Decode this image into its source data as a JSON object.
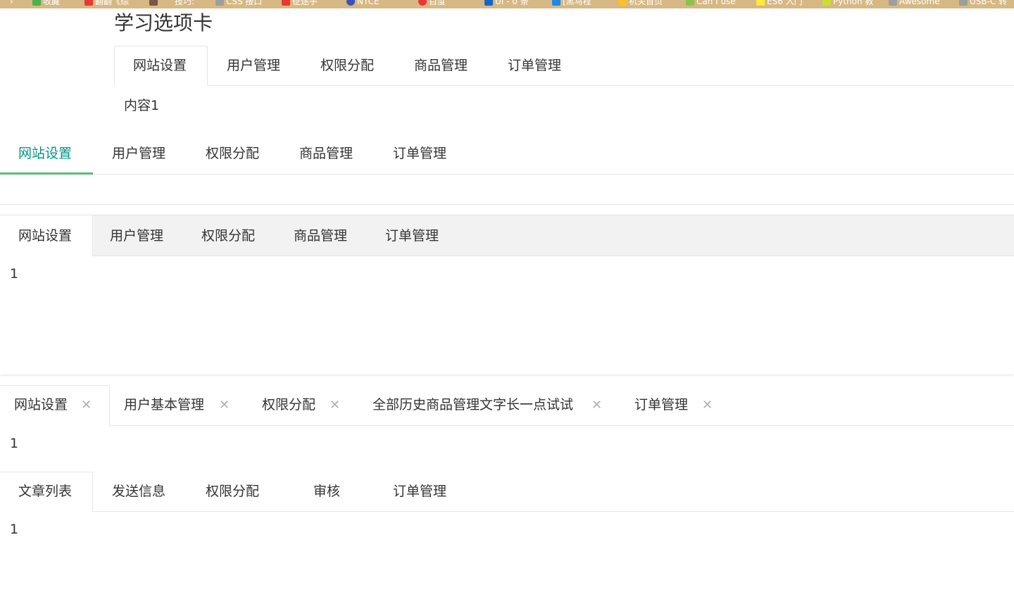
{
  "bookmarks": [
    {
      "label": "收藏",
      "color": "#4caf50"
    },
    {
      "label": "翻翻《综",
      "color": "#e53935"
    },
    {
      "label": "",
      "color": "#795548"
    },
    {
      "label": "技巧:",
      "color": "#9e9e9e"
    },
    {
      "label": "CSS 接口",
      "color": "#9e9e9e"
    },
    {
      "label": "征途手",
      "color": "#e53935"
    },
    {
      "label": "NTCE",
      "color": "#3f51b5"
    },
    {
      "label": "",
      "color": "#9e9e9e"
    },
    {
      "label": "百度",
      "color": "#e53935"
    },
    {
      "label": "",
      "color": "#9e9e9e"
    },
    {
      "label": "UI - 0 条",
      "color": "#1565c0"
    },
    {
      "label": "[黑马程",
      "color": "#1e88e5"
    },
    {
      "label": "机关首页",
      "color": "#fbc02d"
    },
    {
      "label": "Can I use",
      "color": "#8bc34a"
    },
    {
      "label": "ES6 入门",
      "color": "#ffeb3b"
    },
    {
      "label": "Python 教",
      "color": "#cddc39"
    },
    {
      "label": "Awesome",
      "color": "#9e9e9e"
    },
    {
      "label": "USB-C 转",
      "color": "#9e9e9e"
    }
  ],
  "page": {
    "title": "学习选项卡"
  },
  "tabs_brief": {
    "tabs": [
      "网站设置",
      "用户管理",
      "权限分配",
      "商品管理",
      "订单管理"
    ],
    "content": "内容1"
  },
  "tabs_line": {
    "tabs": [
      "网站设置",
      "用户管理",
      "权限分配",
      "商品管理",
      "订单管理"
    ],
    "accent_color": "#009688",
    "underline_color": "#5fb878"
  },
  "tabs_card": {
    "tabs": [
      "网站设置",
      "用户管理",
      "权限分配",
      "商品管理",
      "订单管理"
    ],
    "content": "1"
  },
  "tabs_closable": {
    "tabs": [
      "网站设置",
      "用户基本管理",
      "权限分配",
      "全部历史商品管理文字长一点试试",
      "订单管理"
    ],
    "close_icon": "close-icon",
    "content": "1"
  },
  "tabs_articles": {
    "tabs": [
      "文章列表",
      "发送信息",
      "权限分配",
      "审核",
      "订单管理"
    ],
    "content": "1"
  }
}
